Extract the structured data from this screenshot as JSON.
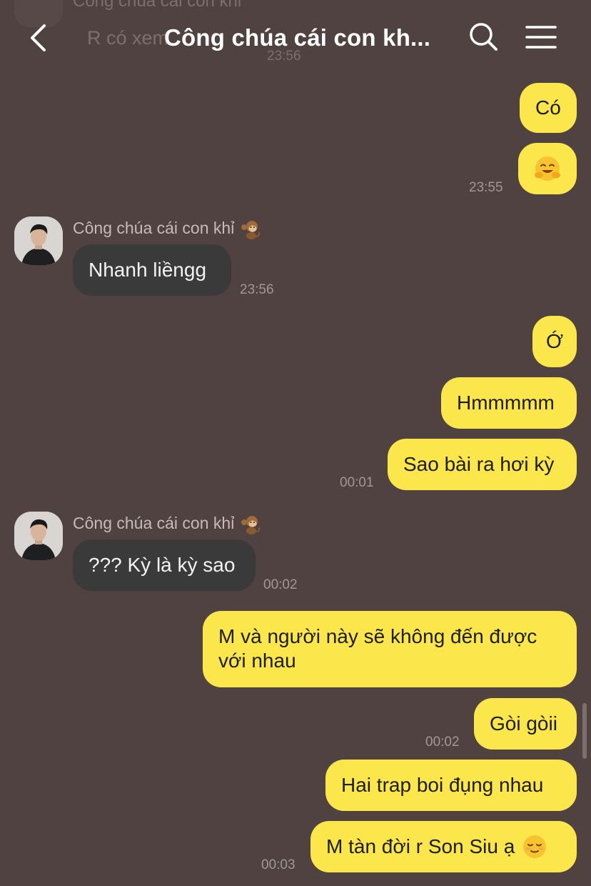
{
  "header": {
    "title": "Công chúa cái con kh...",
    "ghost_sender": "Công chúa cái con khỉ",
    "ghost_message": "R có xem",
    "ghost_time": "23:56"
  },
  "contact": {
    "name": "Công chúa cái con khỉ",
    "name_emoji_icon": "monkey-icon"
  },
  "messages": [
    {
      "side": "out",
      "text": "Có"
    },
    {
      "side": "out",
      "emoji": "smiling-hug-face-icon",
      "time": "23:55"
    },
    {
      "side": "in",
      "text": "Nhanh liềngg",
      "time": "23:56"
    },
    {
      "side": "out",
      "text": "Ớ"
    },
    {
      "side": "out",
      "text": "Hmmmmm"
    },
    {
      "side": "out",
      "text": "Sao bài ra hơi kỳ",
      "time": "00:01"
    },
    {
      "side": "in",
      "text": "??? Kỳ là kỳ sao",
      "time": "00:02"
    },
    {
      "side": "out",
      "text": "M và người này sẽ không đến được với nhau"
    },
    {
      "side": "out",
      "text": "Gòi gòii",
      "time": "00:02"
    },
    {
      "side": "out",
      "text": "Hai trap boi đụng nhau"
    },
    {
      "side": "out",
      "text": "M tàn đời r Son Siu ạ",
      "emoji": "relieved-face-icon",
      "time": "00:03"
    }
  ],
  "colors": {
    "background": "#4f4241",
    "outgoing_bubble": "#fbe64c",
    "incoming_bubble": "#3a3a3a"
  }
}
